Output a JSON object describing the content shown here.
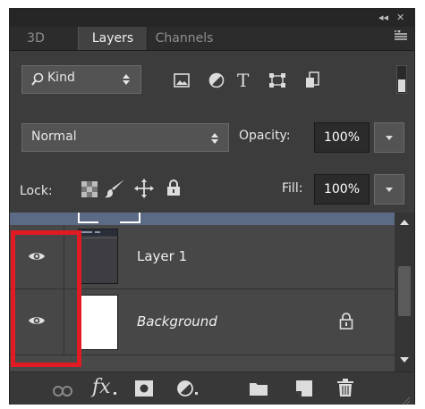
{
  "panel": {
    "topbar": {
      "collapse_label": "◂◂",
      "close_label": "✕"
    },
    "tabs": [
      {
        "label": "3D",
        "active": false
      },
      {
        "label": "Layers",
        "active": true
      },
      {
        "label": "Channels",
        "active": false
      }
    ],
    "filter": {
      "kind_label": "Kind",
      "icons": [
        "pixel-filter-icon",
        "adjustment-filter-icon",
        "type-filter-icon",
        "shape-filter-icon",
        "smart-object-filter-icon"
      ]
    },
    "blend": {
      "mode": "Normal",
      "opacity_label": "Opacity:",
      "opacity_value": "100%"
    },
    "lock": {
      "label": "Lock:",
      "fill_label": "Fill:",
      "fill_value": "100%"
    },
    "layers": [
      {
        "name": "Layer 1",
        "visible": true,
        "italic": false,
        "locked": false
      },
      {
        "name": "Background",
        "visible": true,
        "italic": true,
        "locked": true
      }
    ],
    "bottom_icons": [
      "link-icon",
      "fx-icon",
      "mask-icon",
      "adjustment-icon",
      "folder-icon",
      "new-layer-icon",
      "trash-icon"
    ],
    "fx_label": "fx"
  },
  "annotation": {
    "color": "#e01b24"
  },
  "colors": {
    "panel": "#3c3c3c",
    "selection": "#5b6a85"
  }
}
